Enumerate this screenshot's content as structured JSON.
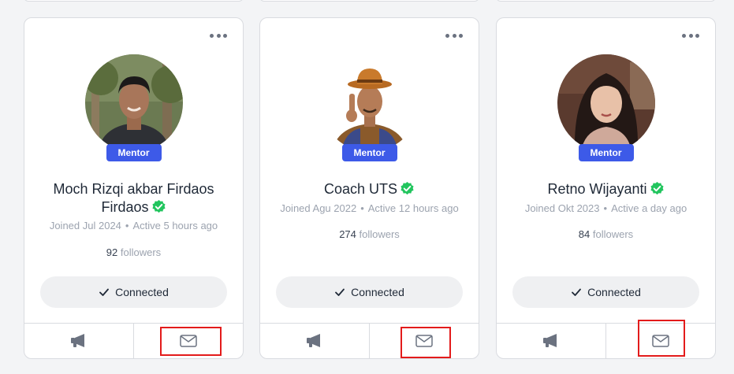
{
  "cards": [
    {
      "badge": "Mentor",
      "name": "Moch Rizqi akbar Firdaos Firdaos",
      "name_line1": "Moch Rizqi akbar Firdaos",
      "name_line2": "Firdaos",
      "joined": "Joined Jul 2024",
      "active": "Active 5 hours ago",
      "followers_count": "92",
      "followers_label": "followers",
      "connect_label": "Connected"
    },
    {
      "badge": "Mentor",
      "name": "Coach UTS",
      "joined": "Joined Agu 2022",
      "active": "Active 12 hours ago",
      "followers_count": "274",
      "followers_label": "followers",
      "connect_label": "Connected"
    },
    {
      "badge": "Mentor",
      "name": "Retno Wijayanti",
      "joined": "Joined Okt 2023",
      "active": "Active a day ago",
      "followers_count": "84",
      "followers_label": "followers",
      "connect_label": "Connected"
    }
  ],
  "meta_separator": "•",
  "icons": {
    "more": "more-horizontal-icon",
    "verified": "verified-check-icon",
    "check": "check-icon",
    "megaphone": "megaphone-icon",
    "mail": "mail-icon"
  },
  "colors": {
    "badge": "#3d5ae8",
    "verified": "#22c55e",
    "highlight": "#e31b1b"
  }
}
